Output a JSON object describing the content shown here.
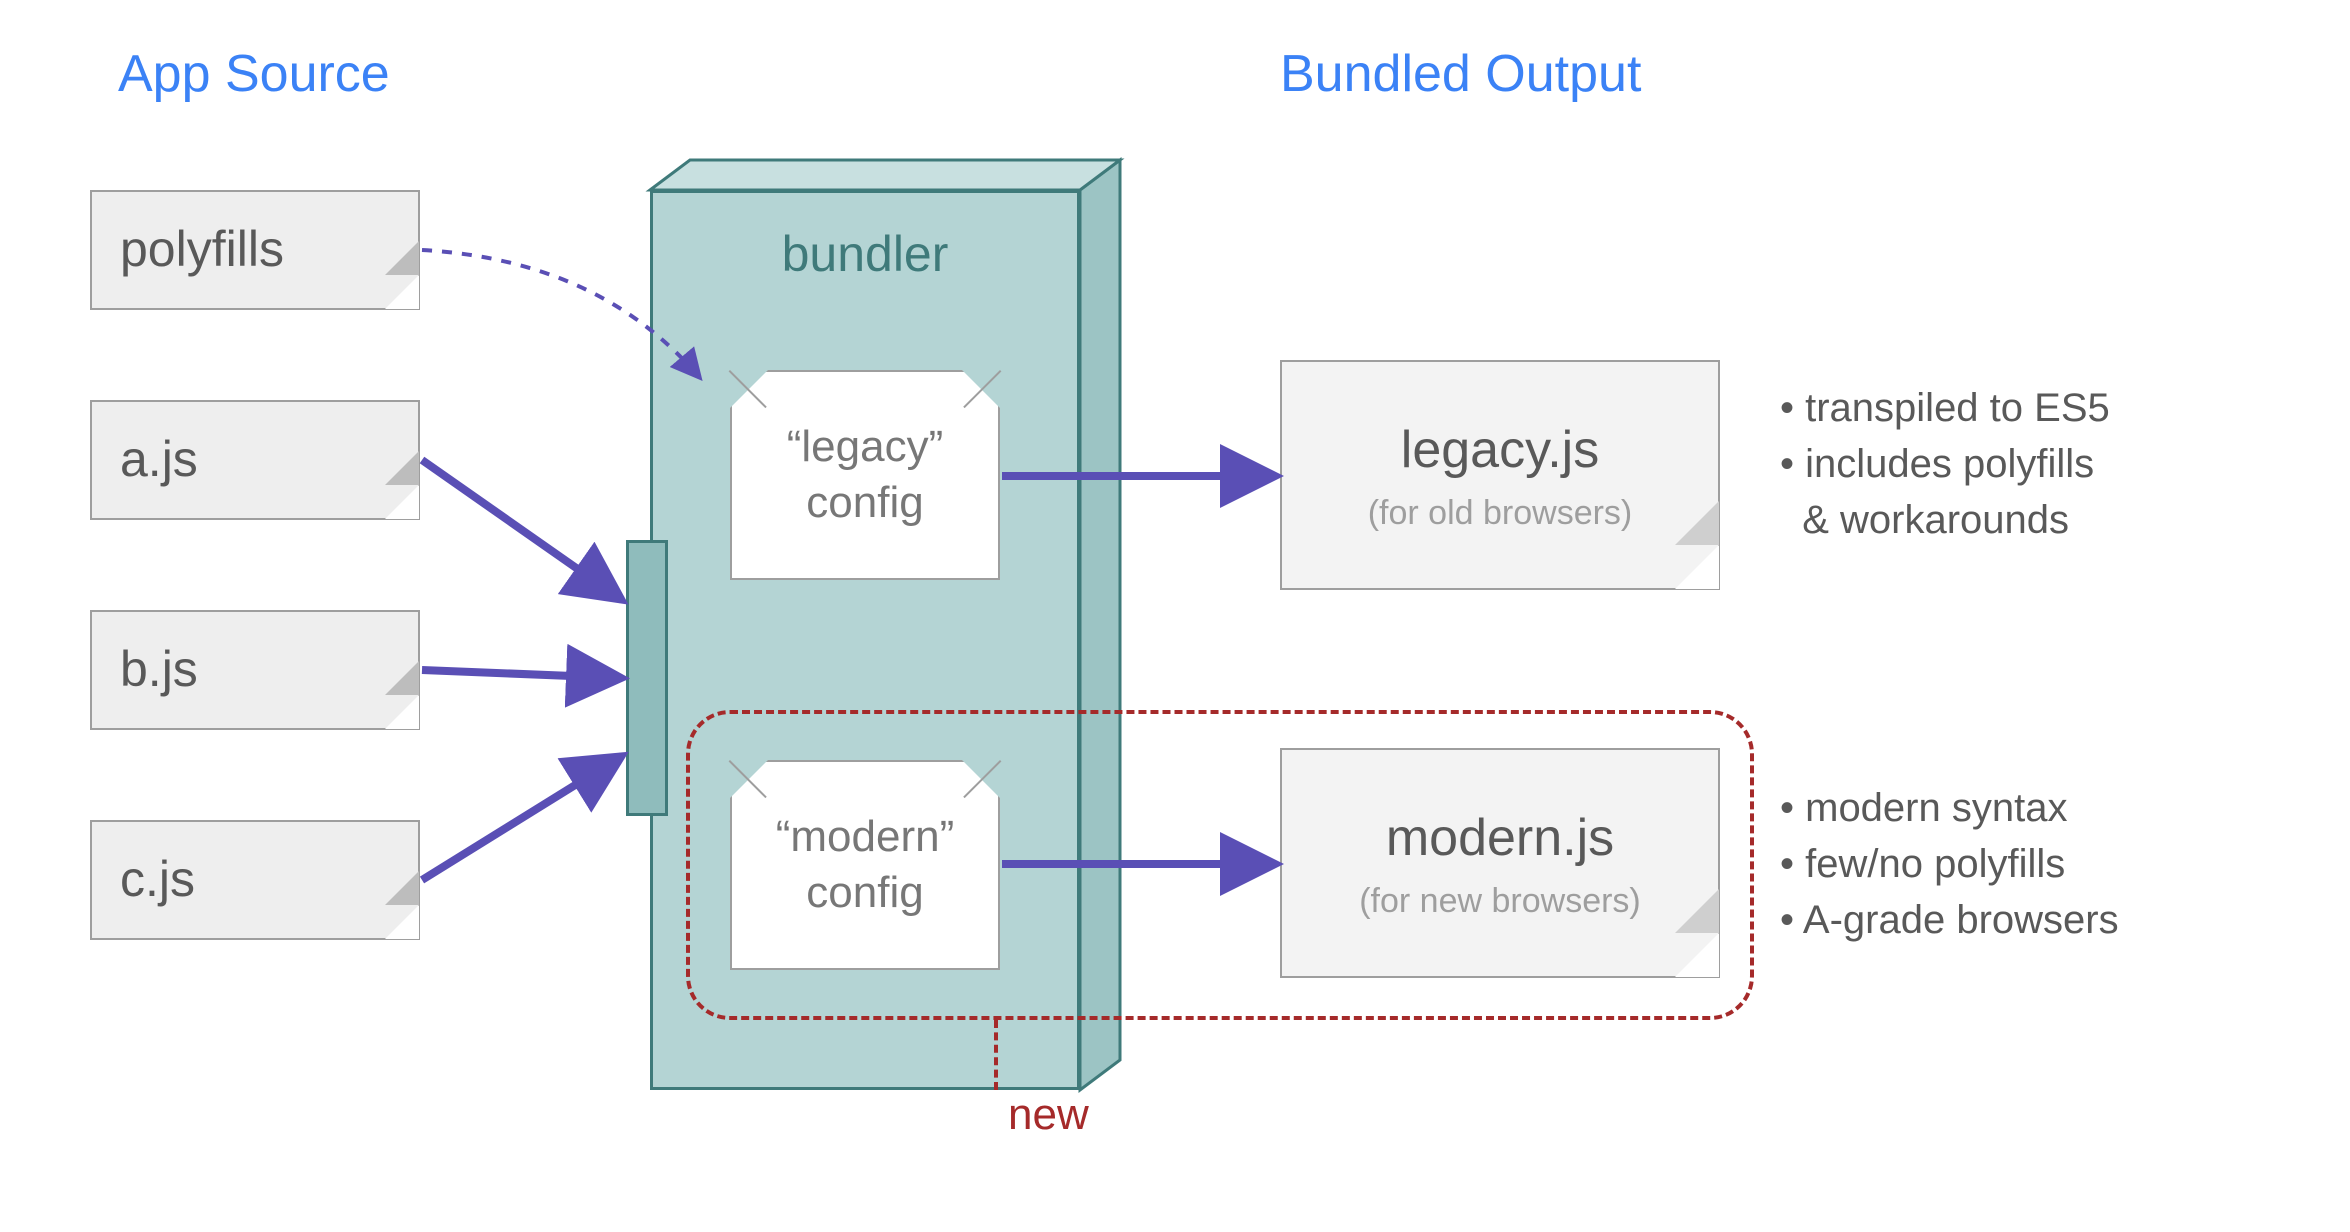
{
  "headings": {
    "source": "App Source",
    "output": "Bundled Output"
  },
  "source_files": {
    "polyfills": "polyfills",
    "a": "a.js",
    "b": "b.js",
    "c": "c.js"
  },
  "bundler": {
    "title": "bundler",
    "configs": {
      "legacy": {
        "line1": "“legacy”",
        "line2": "config"
      },
      "modern": {
        "line1": "“modern”",
        "line2": "config"
      }
    }
  },
  "outputs": {
    "legacy": {
      "name": "legacy.js",
      "note": "(for old browsers)"
    },
    "modern": {
      "name": "modern.js",
      "note": "(for new browsers)"
    }
  },
  "bullets": {
    "legacy": {
      "b1": "• transpiled to ES5",
      "b2": "• includes polyfills",
      "b3": "  & workarounds"
    },
    "modern": {
      "b1": "• modern syntax",
      "b2": "• few/no polyfills",
      "b3": "• A-grade browsers"
    }
  },
  "annotations": {
    "new": "new"
  },
  "colors": {
    "heading": "#3b82f6",
    "arrow": "#5a4fb5",
    "bundler_border": "#3f7a7a",
    "bundler_fill": "#b4d4d4",
    "new": "#a52a2a"
  }
}
